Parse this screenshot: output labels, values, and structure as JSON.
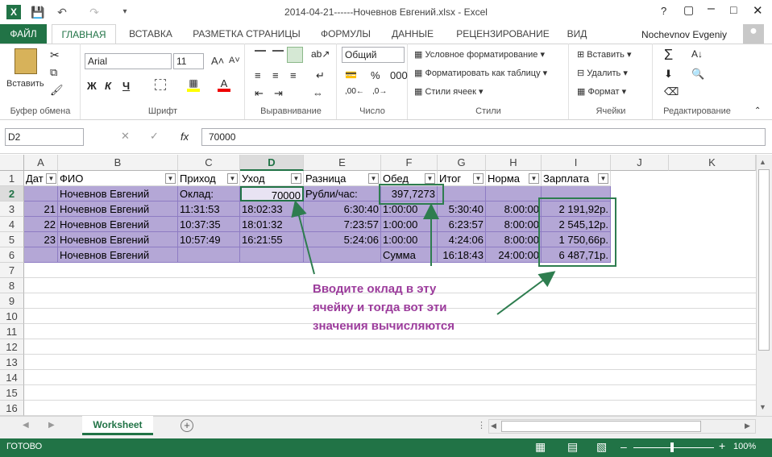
{
  "window": {
    "title": "2014-04-21------Ночевнов Евгений.xlsx - Excel",
    "help": "?",
    "user": "Nochevnov Evgeniy"
  },
  "tabs": [
    "ФАЙЛ",
    "ГЛАВНАЯ",
    "ВСТАВКА",
    "РАЗМЕТКА СТРАНИЦЫ",
    "ФОРМУЛЫ",
    "ДАННЫЕ",
    "РЕЦЕНЗИРОВАНИЕ",
    "ВИД"
  ],
  "ribbon": {
    "paste": "Вставить",
    "font": "Arial",
    "size": "11",
    "bold": "Ж",
    "italic": "К",
    "underline": "Ч",
    "numformat": "Общий",
    "cond": "Условное форматирование",
    "table": "Форматировать как таблицу",
    "styles": "Стили ячеек",
    "insert": "Вставить",
    "delete": "Удалить",
    "format": "Формат",
    "groups": [
      "Буфер обмена",
      "Шрифт",
      "Выравнивание",
      "Число",
      "Стили",
      "Ячейки",
      "Редактирование"
    ]
  },
  "formula": {
    "namebox": "D2",
    "fx": "fx",
    "value": "70000"
  },
  "columns": [
    "A",
    "B",
    "C",
    "D",
    "E",
    "F",
    "G",
    "H",
    "I",
    "J",
    "K"
  ],
  "rows": [
    "1",
    "2",
    "3",
    "4",
    "5",
    "6",
    "7",
    "8",
    "9",
    "10",
    "11",
    "12",
    "13",
    "14",
    "15",
    "16"
  ],
  "table": {
    "headers": [
      "Дат",
      "ФИО",
      "Приход",
      "Уход",
      "Разница",
      "Обед",
      "Итог",
      "Норма",
      "Зарплата"
    ],
    "r2": [
      "",
      "Ночевнов Евгений",
      "Оклад:",
      "70000",
      "Рубли/час:",
      "397,7273",
      "",
      "",
      ""
    ],
    "r3": [
      "21",
      "Ночевнов Евгений",
      "11:31:53",
      "18:02:33",
      "6:30:40",
      "1:00:00",
      "5:30:40",
      "8:00:00",
      "2 191,92р."
    ],
    "r4": [
      "22",
      "Ночевнов Евгений",
      "10:37:35",
      "18:01:32",
      "7:23:57",
      "1:00:00",
      "6:23:57",
      "8:00:00",
      "2 545,12р."
    ],
    "r5": [
      "23",
      "Ночевнов Евгений",
      "10:57:49",
      "16:21:55",
      "5:24:06",
      "1:00:00",
      "4:24:06",
      "8:00:00",
      "1 750,66р."
    ],
    "r6": [
      "",
      "Ночевнов Евгений",
      "",
      "",
      "",
      "Сумма",
      "16:18:43",
      "24:00:00",
      "6 487,71р."
    ]
  },
  "annotation": [
    "Вводите оклад в эту",
    "ячейку и тогда вот эти",
    "значения вычисляются"
  ],
  "sheet": "Worksheet",
  "status": {
    "ready": "ГОТОВО",
    "zoom": "100%"
  },
  "colors": {
    "accent": "#217346",
    "band": "#b4a7d6",
    "annotation": "#9c3c9c"
  }
}
